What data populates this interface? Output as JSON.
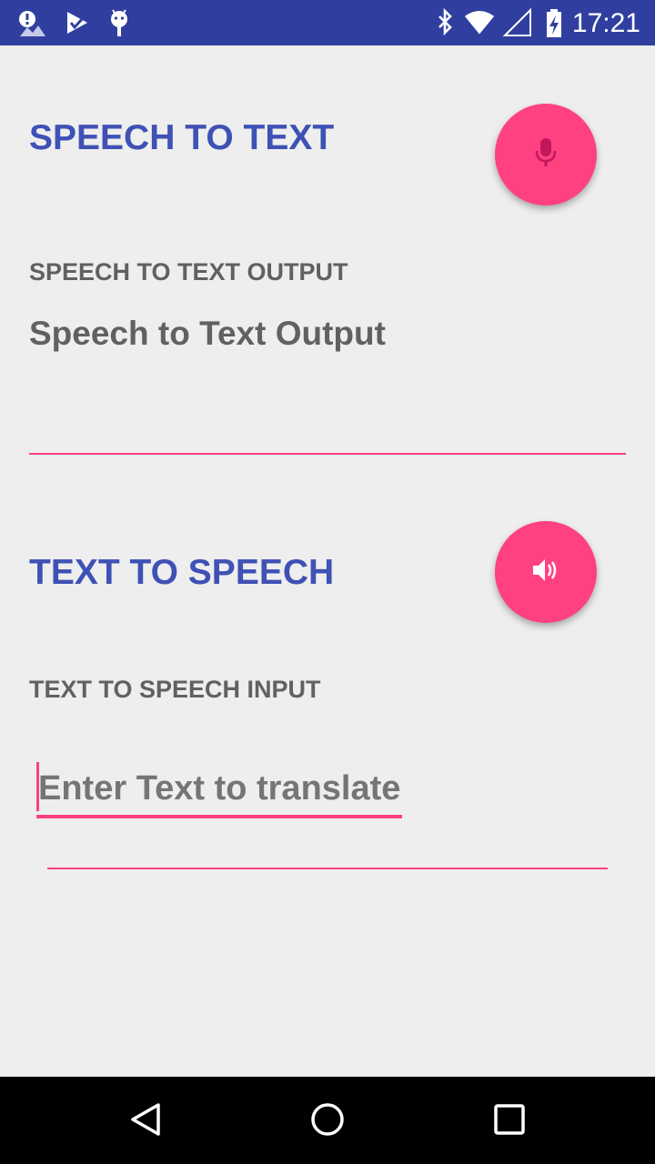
{
  "status_bar": {
    "time": "17:21",
    "icons_left": [
      "alert-icon",
      "check-icon",
      "android-icon"
    ],
    "icons_right": [
      "bluetooth-icon",
      "wifi-icon",
      "signal-icon",
      "battery-charging-icon"
    ]
  },
  "speech_to_text": {
    "title": "SPEECH TO TEXT",
    "mic_button_icon": "microphone-icon",
    "output_label": "SPEECH TO TEXT OUTPUT",
    "output_value": "Speech to Text Output"
  },
  "text_to_speech": {
    "title": "TEXT TO SPEECH",
    "speak_button_icon": "speaker-icon",
    "input_label": "TEXT TO SPEECH INPUT",
    "input_value": "",
    "input_placeholder": "Enter Text to translate"
  },
  "navigation": {
    "buttons": [
      "back-icon",
      "home-icon",
      "recents-icon"
    ]
  },
  "colors": {
    "primary_dark": "#303f9f",
    "primary": "#3f51b5",
    "accent": "#ff4081",
    "background": "#eeeeee"
  }
}
